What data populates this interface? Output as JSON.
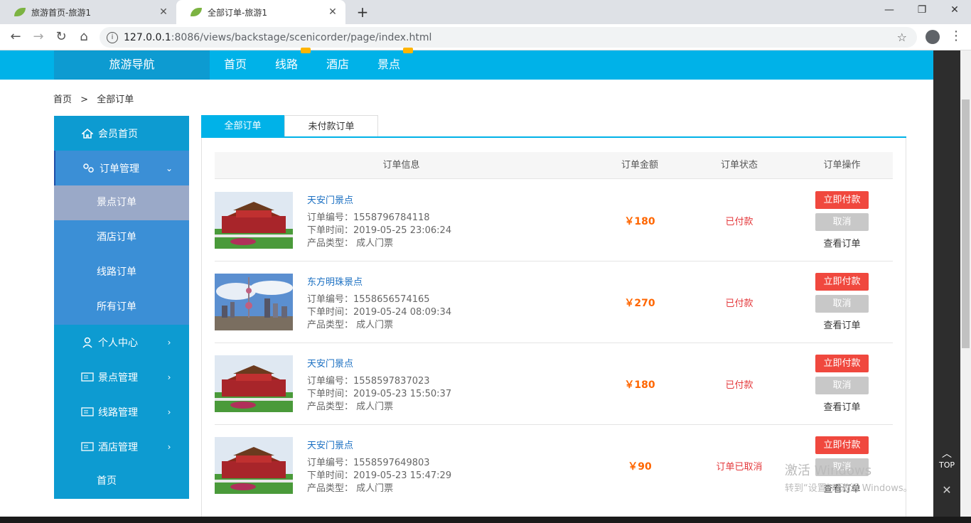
{
  "browser": {
    "tabs": [
      {
        "title": "旅游首页-旅游1"
      },
      {
        "title": "全部订单-旅游1"
      }
    ],
    "url_host": "127.0.0.1",
    "url_rest": ":8086/views/backstage/scenicorder/page/index.html"
  },
  "topnav": {
    "brand": "旅游导航",
    "links": [
      "首页",
      "线路",
      "酒店",
      "景点"
    ]
  },
  "breadcrumb": {
    "home": "首页",
    "sep": ">",
    "current": "全部订单"
  },
  "sidebar": {
    "member_home": "会员首页",
    "order_mgmt": "订单管理",
    "sub": [
      "景点订单",
      "酒店订单",
      "线路订单",
      "所有订单"
    ],
    "personal": "个人中心",
    "scenic_mgmt": "景点管理",
    "route_mgmt": "线路管理",
    "hotel_mgmt": "酒店管理",
    "home": "首页"
  },
  "order_tabs": {
    "all": "全部订单",
    "unpaid": "未付款订单"
  },
  "table_headers": {
    "info": "订单信息",
    "amount": "订单金额",
    "status": "订单状态",
    "ops": "订单操作"
  },
  "labels": {
    "order_no": "订单编号：",
    "order_time": "下单时间：",
    "product_type": "产品类型：",
    "pay": "立即付款",
    "cancel": "取消",
    "view": "查看订单"
  },
  "orders": [
    {
      "name": "天安门景点",
      "no": "1558796784118",
      "time": "2019-05-25 23:06:24",
      "type": "成人门票",
      "amount": "￥180",
      "status": "已付款"
    },
    {
      "name": "东方明珠景点",
      "no": "1558656574165",
      "time": "2019-05-24 08:09:34",
      "type": "成人门票",
      "amount": "￥270",
      "status": "已付款"
    },
    {
      "name": "天安门景点",
      "no": "1558597837023",
      "time": "2019-05-23 15:50:37",
      "type": "成人门票",
      "amount": "￥180",
      "status": "已付款"
    },
    {
      "name": "天安门景点",
      "no": "1558597649803",
      "time": "2019-05-23 15:47:29",
      "type": "成人门票",
      "amount": "￥90",
      "status": "订单已取消"
    }
  ],
  "side_tools": {
    "top": "TOP"
  },
  "watermark": {
    "line1": "激活 Windows",
    "line2": "转到“设置”以激活 Windows。"
  }
}
